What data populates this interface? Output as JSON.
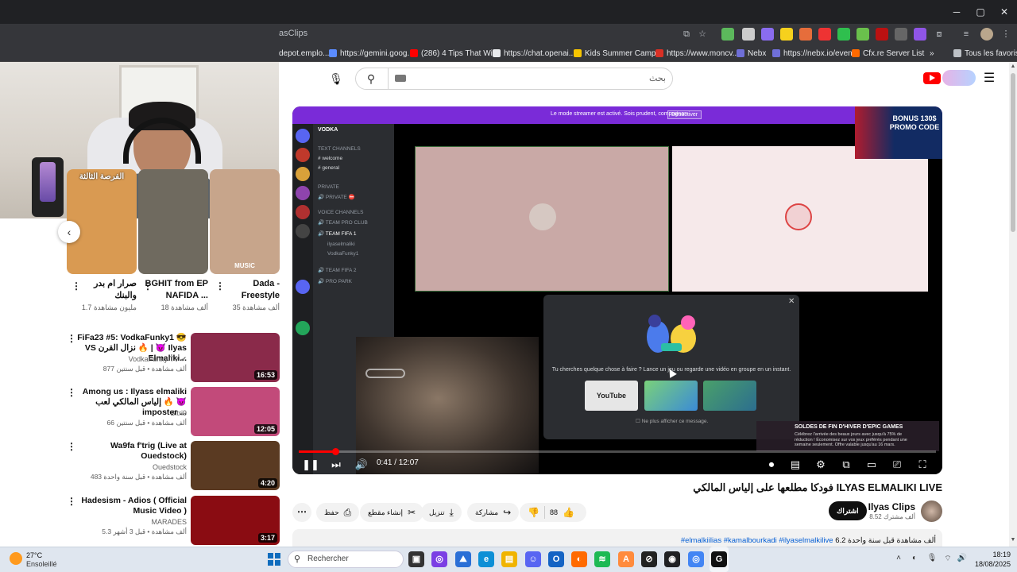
{
  "browser": {
    "url": "asClips",
    "window_controls": {
      "minimize": "─",
      "maximize": "▢",
      "close": "✕"
    },
    "bookmarks": [
      {
        "label": "depot.emplo...",
        "color": "#3c8cff"
      },
      {
        "label": "https://gemini.goog...",
        "color": "#5b8cff"
      },
      {
        "label": "(286) 4 Tips That Wi...",
        "color": "#ff0000"
      },
      {
        "label": "https://chat.openai....",
        "color": "#e8eaed"
      },
      {
        "label": "Kids Summer Camp...",
        "color": "#f6c400"
      },
      {
        "label": "https://www.moncv...",
        "color": "#d93025"
      },
      {
        "label": "Nebx",
        "color": "#6f6fd8"
      },
      {
        "label": "https://nebx.io/event",
        "color": "#6f6fd8"
      },
      {
        "label": "Cfx.re Server List",
        "color": "#ff6a00"
      }
    ],
    "all_bookmarks": "Tous les favoris",
    "more_bookmarks": "»"
  },
  "youtube": {
    "search_placeholder": "بحث",
    "mic_icon": "mic-icon",
    "search_icon": "search-icon",
    "menu_icon": "☰"
  },
  "shorts": [
    {
      "title": "Dada - Freestyle",
      "views": "35 ألف مشاهدة",
      "thumb": "#c7a58b",
      "badge": "MUSIC"
    },
    {
      "title": "BGHIT from EP NAFIDA ...",
      "views": "18 ألف مشاهدة",
      "thumb": "#6f6a5f",
      "badge": ""
    },
    {
      "title": "صرار ام بدر والبنك",
      "views": "1.7 مليون مشاهدة",
      "thumb": "#d99a52",
      "badge": "الفرصة الثالثة"
    }
  ],
  "recommendations": [
    {
      "title": "FiFa23 #5: VodkaFunky1 😎 VS نزال القرن 🔥 | 😈 Ilyas Elmaliki...",
      "channel": "VodkaFunky TV ✔",
      "meta": "877 ألف مشاهدة • قبل سنتين",
      "duration": "16:53",
      "thumb": "#8a2a4a"
    },
    {
      "title": "Among us : Ilyass elmaliki إلياس المالكي لعب 🔥 😈 imposter ...",
      "channel": "Bitri9",
      "meta": "66 ألف مشاهدة • قبل سنتين",
      "duration": "12:05",
      "thumb": "#c24a7a"
    },
    {
      "title": "Wa9fa f'trig (Live at Ouedstock)",
      "channel": "Ouedstock",
      "meta": "483 ألف مشاهدة • قبل سنة واحدة",
      "duration": "4:20",
      "thumb": "#5a3a22"
    },
    {
      "title": "Hadesism - Adios ( Official Music Video )",
      "channel": "MARADES",
      "meta": "5.3 ألف مشاهدة • قبل 3 أشهر",
      "duration": "3:17",
      "thumb": "#8a0c12"
    }
  ],
  "player": {
    "discord": {
      "server_name": "VODKA",
      "streamer_notice": "Le mode streamer est activé. Sois prudent, compagnon.",
      "streamer_button": "Désactiver",
      "channels": [
        {
          "label": "TEXT CHANNELS"
        },
        {
          "label": "# welcome"
        },
        {
          "label": "# general"
        },
        {
          "label": "PRIVATE"
        },
        {
          "label": "🔊 PRIVATE ⛔"
        },
        {
          "label": "VOICE CHANNELS"
        },
        {
          "label": "🔊 TEAM PRO CLUB"
        },
        {
          "label": "🔊 TEAM FIFA 1"
        },
        {
          "label": "ilyaselmaliki"
        },
        {
          "label": "VodkaFunky1"
        },
        {
          "label": "🔊 TEAM FIFA 2"
        },
        {
          "label": "🔊 PRO PARK"
        }
      ],
      "modal_text": "Tu cherches quelque chose à faire ? Lance un jeu ou regarde une vidéo en groupe en un instant.",
      "modal_youtube": "YouTube",
      "modal_checkbox": "Ne plus afficher ce message."
    },
    "bet_ad": "BONUS 130$ PROMO CODE",
    "epic_ad": {
      "title": "SOLDES DE FIN D'HIVER D'EPIC GAMES",
      "body": "Célébrez l'arrivée des beaux jours avec jusqu'à 75% de réduction ! Économisez sur vos jeux préférés pendant une semaine seulement. Offre valable jusqu'au 16 mars."
    },
    "time": "0:41 / 12:07",
    "progress": 0.057
  },
  "video": {
    "title": "فودكا مطلعها على إلياس المالكي ILYAS ELMALIKI LIVE",
    "channel_name": "Ilyas Clips",
    "channel_subs": "8.52 ألف مشترك",
    "subscribe": "اشتراك",
    "likes": "88",
    "share": "مشاركة",
    "download": "تنزيل",
    "clip": "إنشاء مقطع",
    "save": "حفظ",
    "description_stats": "6.2 ألف مشاهدة قبل سنة واحدة",
    "description_tags": "#elmalkiilias #kamalbourkadi #ilyaselmalkilive"
  },
  "taskbar": {
    "temp": "27°C",
    "weather": "Ensoleillé",
    "search": "Rechercher",
    "time": "18:19",
    "date": "18/08/2025",
    "apps": [
      {
        "icon": "▣",
        "color": "#333333"
      },
      {
        "icon": "◎",
        "color": "#7b3fe4"
      },
      {
        "icon": "⛰",
        "color": "#2a6fd6"
      },
      {
        "icon": "e",
        "color": "#0c8fd6"
      },
      {
        "icon": "▤",
        "color": "#f0b400"
      },
      {
        "icon": "☺",
        "color": "#5865f2"
      },
      {
        "icon": "O",
        "color": "#1463c4"
      },
      {
        "icon": "◐",
        "color": "#ff6a00"
      },
      {
        "icon": "≋",
        "color": "#1db954"
      },
      {
        "icon": "A",
        "color": "#ff8b3d"
      },
      {
        "icon": "⊘",
        "color": "#222222"
      },
      {
        "icon": "◉",
        "color": "#202124"
      },
      {
        "icon": "◎",
        "color": "#4285f4"
      },
      {
        "icon": "G",
        "color": "#111111"
      }
    ]
  }
}
